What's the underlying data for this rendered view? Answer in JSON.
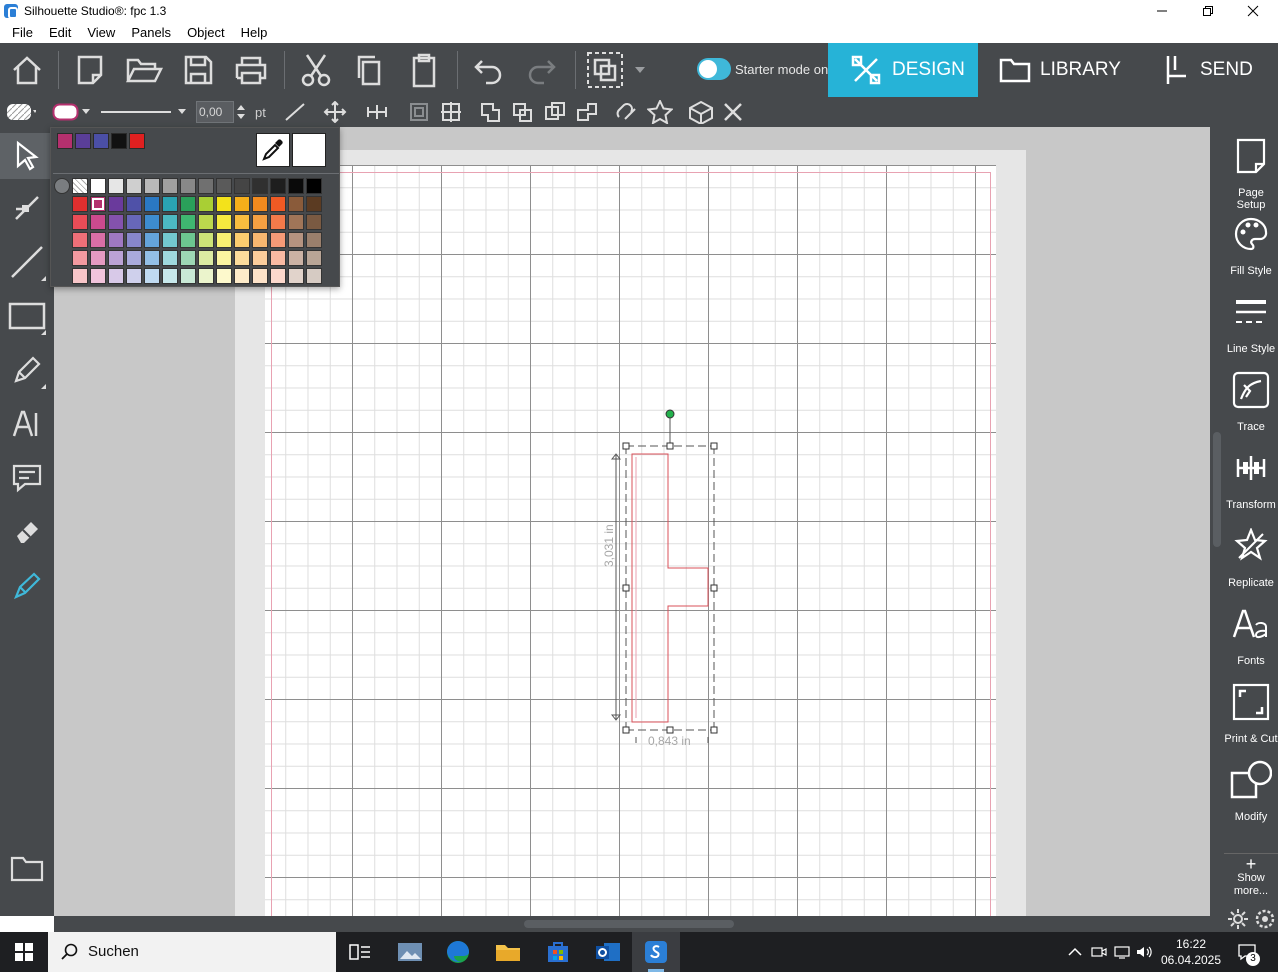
{
  "window": {
    "title": "Silhouette Studio®: fpc 1.3"
  },
  "menu": [
    "File",
    "Edit",
    "View",
    "Panels",
    "Object",
    "Help"
  ],
  "toolbar": {
    "starter_mode_label": "Starter mode on",
    "tabs": [
      {
        "label": "DESIGN",
        "active": true
      },
      {
        "label": "LIBRARY"
      },
      {
        "label": "SEND"
      }
    ]
  },
  "props": {
    "line_width": "0,00",
    "unit": "pt"
  },
  "right_panel": [
    "Page Setup",
    "Fill Style",
    "Line Style",
    "Trace",
    "Transform",
    "Replicate",
    "Fonts",
    "Print & Cut",
    "Modify"
  ],
  "show_more": {
    "plus": "+",
    "label": "Show more..."
  },
  "palette": {
    "recent_colors": [
      "#b5306e",
      "#5a3e98",
      "#4b4fa6",
      "#111111",
      "#e02020"
    ],
    "rows": [
      [
        "none",
        "transparent",
        "#ffffff",
        "#e6e6e6",
        "#cfcfcf",
        "#b8b8b8",
        "#a0a0a0",
        "#888888",
        "#707070",
        "#5a5a5a",
        "#454545",
        "#303030",
        "#1e1e1e",
        "#0a0a0a",
        "#000000"
      ],
      [
        "blank",
        "#e02f2f",
        "#b5306e",
        "#6a3a9c",
        "#4f51a8",
        "#2a78c3",
        "#2aa3b3",
        "#2aa05a",
        "#a9cf34",
        "#f3e21b",
        "#f5ae1a",
        "#f28a1e",
        "#f05a24",
        "#8a5b3a",
        "#5b3b22"
      ],
      [
        "blank",
        "#ea4c57",
        "#cc4a8e",
        "#8452ad",
        "#6767b9",
        "#3d8ccf",
        "#4cb9c2",
        "#3fb670",
        "#bcd84d",
        "#f6e93f",
        "#f8bd3f",
        "#f5a042",
        "#f37a4a",
        "#a07558",
        "#7a5a42"
      ],
      [
        "blank",
        "#ee6f78",
        "#d96ea6",
        "#9f78c1",
        "#8787ca",
        "#64a4db",
        "#73c9cf",
        "#6cc690",
        "#cde278",
        "#f8ef72",
        "#fbcd6f",
        "#f8b76f",
        "#f69a77",
        "#b59380",
        "#9a7f6c"
      ],
      [
        "blank",
        "#f39aa0",
        "#e59ac2",
        "#bba2d5",
        "#a9aadb",
        "#93bfe6",
        "#9fd9dd",
        "#9dd7b4",
        "#dcebA2",
        "#fbf4a0",
        "#fcdc9c",
        "#fbcd9c",
        "#f9b9a2",
        "#cbb2a4",
        "#b9a596"
      ],
      [
        "blank",
        "#f8c6c9",
        "#f1c4dc",
        "#d8c9e8",
        "#cfd0ec",
        "#c0daf1",
        "#c8e9ec",
        "#c8e8d5",
        "#ebf4cc",
        "#fdf9cc",
        "#fdebc9",
        "#fde3c9",
        "#fcd8cc",
        "#e1d3cb",
        "#d6cbc3"
      ]
    ]
  },
  "selection": {
    "height_label": "3,031 in",
    "width_label": "0,843 in"
  },
  "taskbar": {
    "search_label": "Suchen",
    "time": "16:22",
    "date": "06.04.2025",
    "notification_count": "3"
  },
  "colors": {
    "accent": "#26b3d7",
    "chrome": "#46494c",
    "cut_line": "#d9505a"
  }
}
